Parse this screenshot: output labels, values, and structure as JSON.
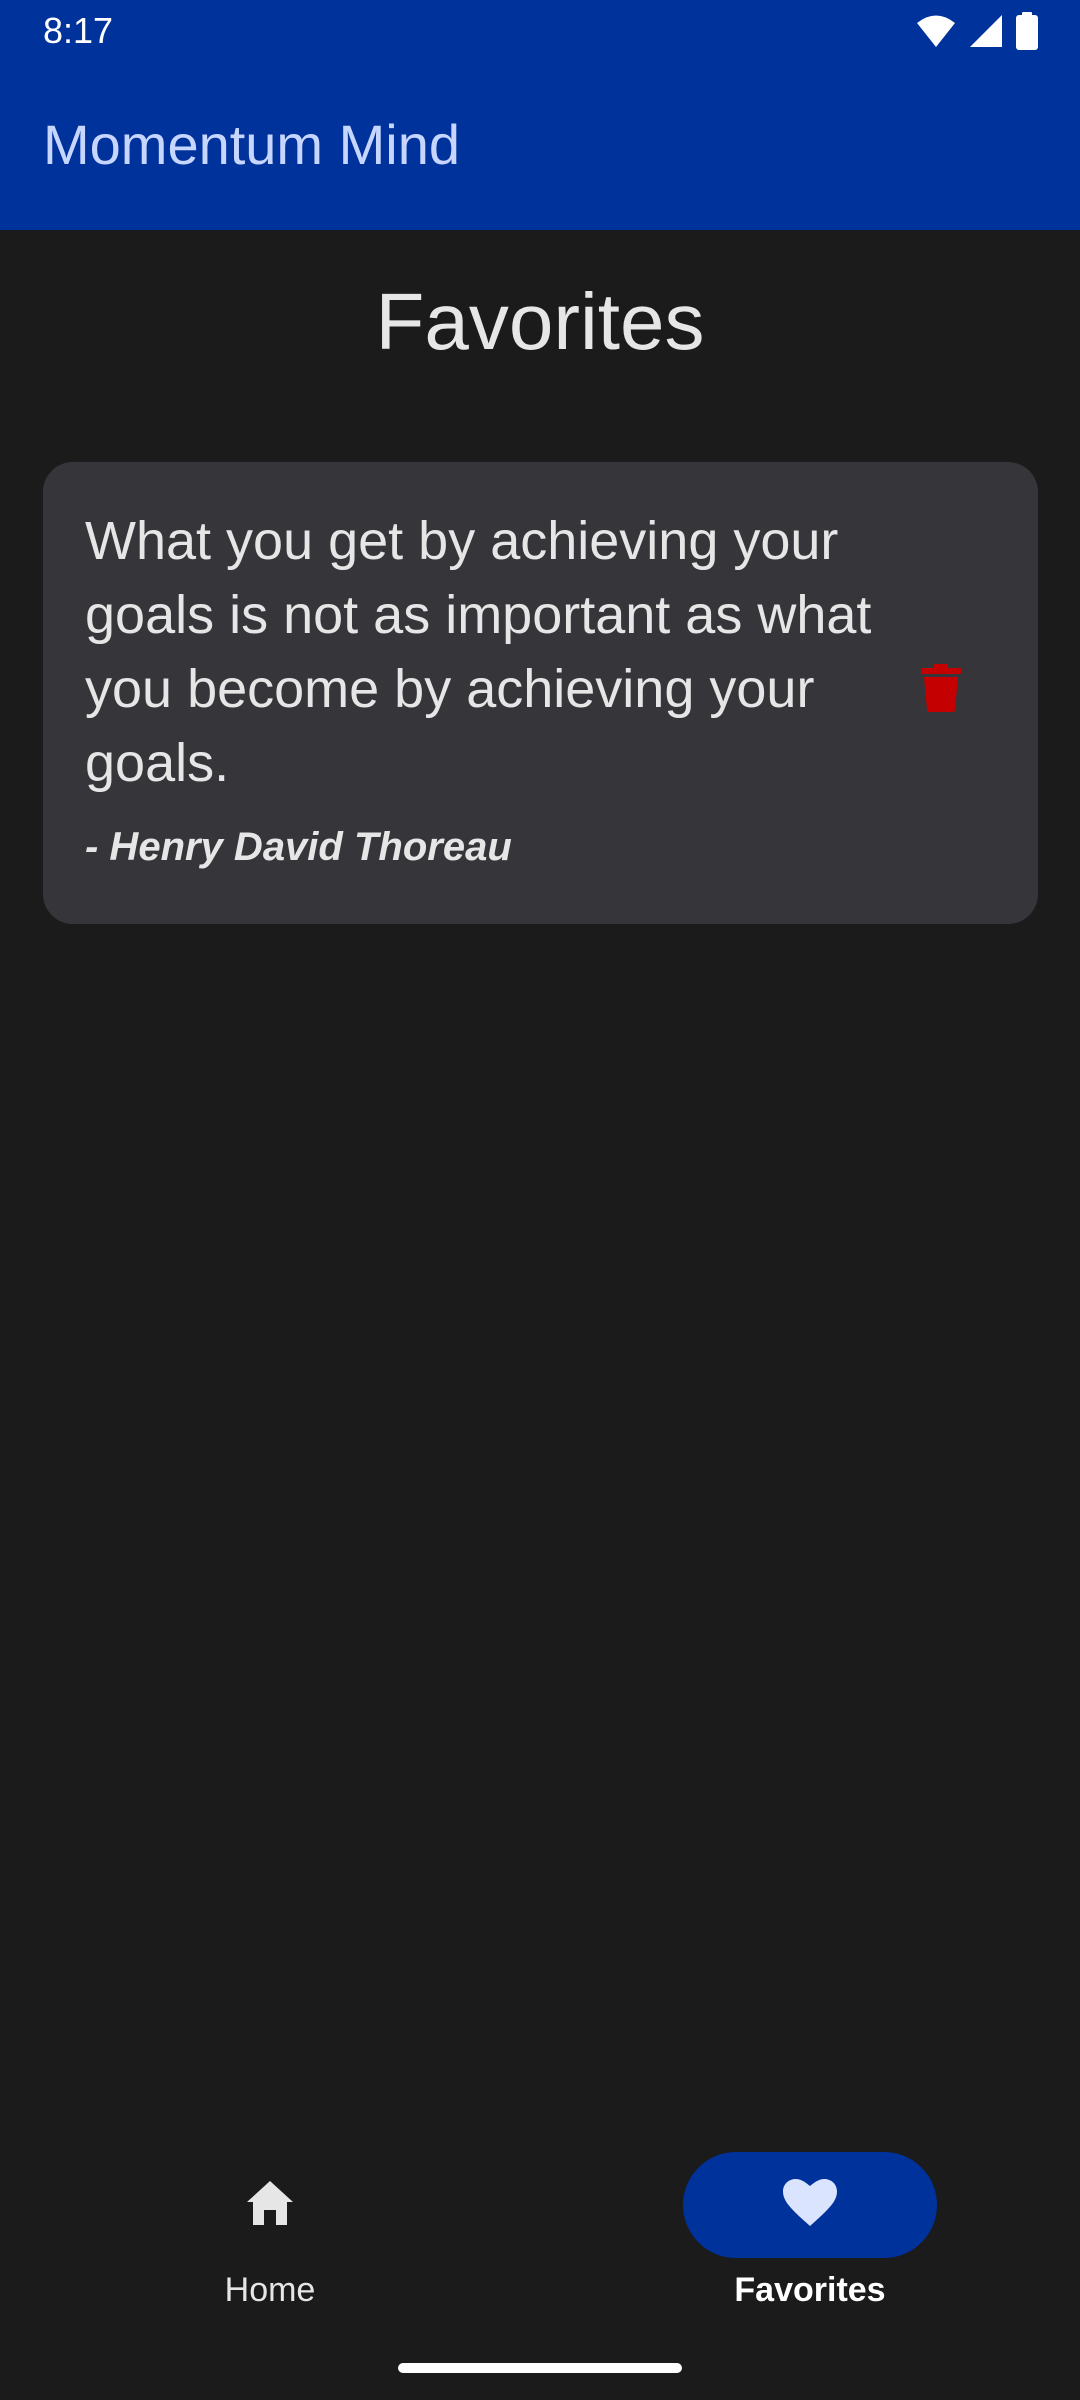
{
  "status_bar": {
    "time": "8:17",
    "icons": [
      "wifi-icon",
      "signal-icon",
      "battery-icon"
    ]
  },
  "app_bar": {
    "title": "Momentum Mind"
  },
  "page": {
    "title": "Favorites"
  },
  "favorites": [
    {
      "quote": "What you get by achieving your goals is not as important as what you become by achieving your goals.",
      "author": "- Henry David Thoreau",
      "delete_icon": "trash-icon"
    }
  ],
  "bottom_nav": {
    "items": [
      {
        "label": "Home",
        "icon": "home-icon",
        "selected": false
      },
      {
        "label": "Favorites",
        "icon": "heart-icon",
        "selected": true
      }
    ]
  },
  "colors": {
    "primary": "#00329c",
    "background": "#1b1b1c",
    "card": "#36353a",
    "app_title": "#c7d6ff",
    "delete": "#c40000"
  }
}
